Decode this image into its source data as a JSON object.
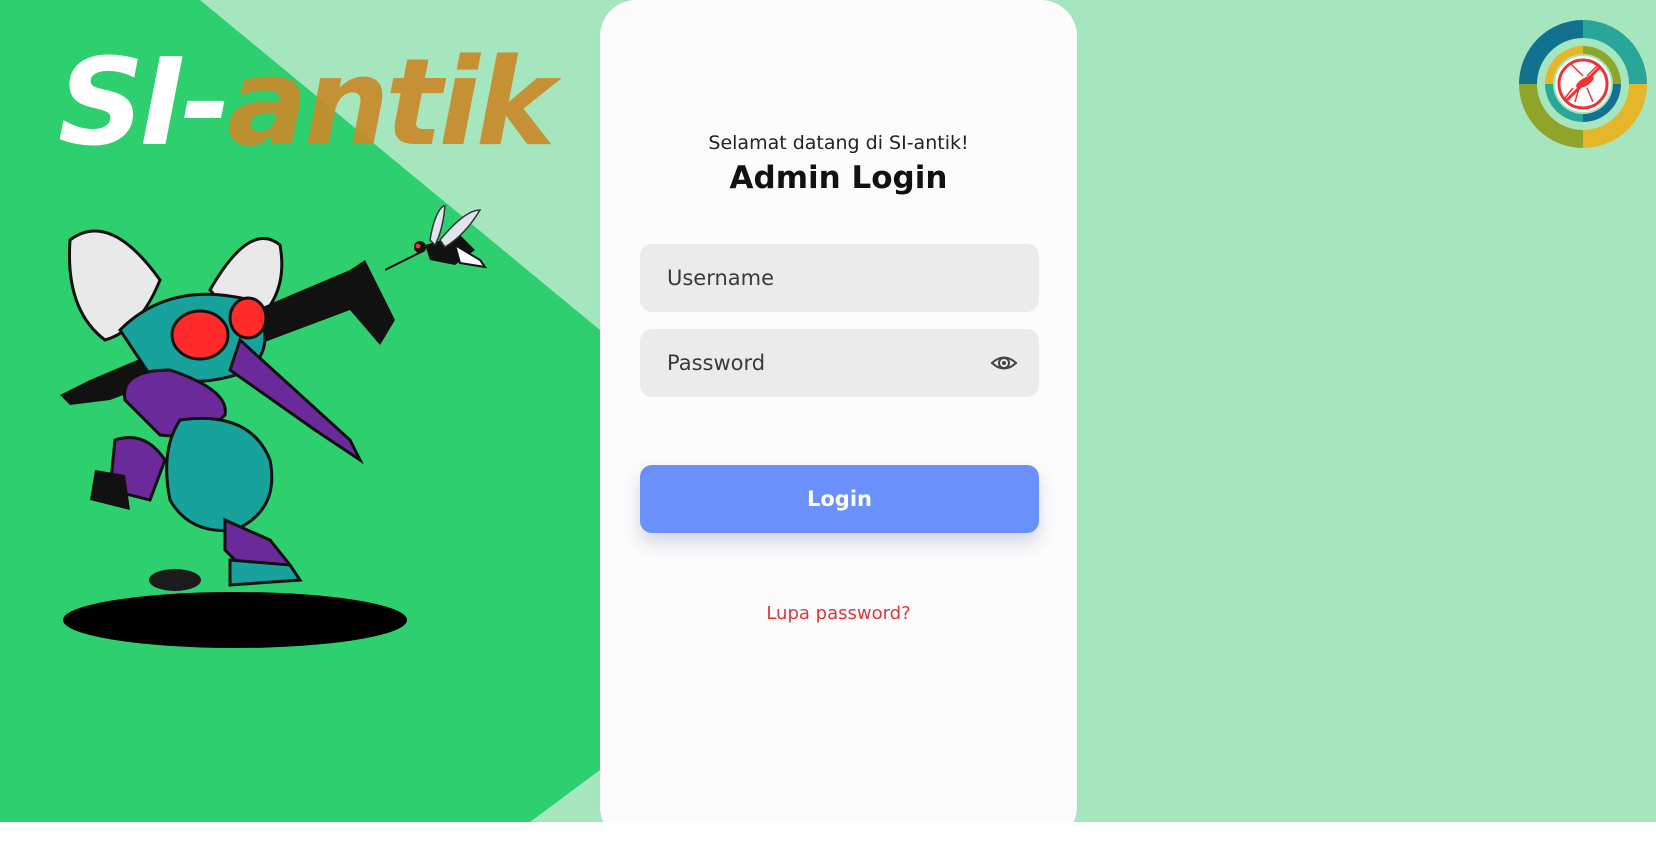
{
  "brand": {
    "part_a": "SI-",
    "part_b": "antik"
  },
  "card": {
    "welcome": "Selamat datang di SI-antik!",
    "title": "Admin Login"
  },
  "form": {
    "username_placeholder": "Username",
    "password_placeholder": "Password",
    "login_label": "Login",
    "forgot_label": "Lupa password?"
  },
  "icons": {
    "show_password": "eye-icon",
    "logo": "anti-mosquito-logo-icon",
    "mascot": "mosquito-mascot-illustration",
    "mosquito": "mosquito-icon"
  },
  "colors": {
    "background_light": "#a6e6bf",
    "background_green": "#2ecf6f",
    "card": "#fcfcfc",
    "login_button": "#6a90fc",
    "forgot_link": "#d9383a",
    "brand_accent": "#c98a2a"
  }
}
